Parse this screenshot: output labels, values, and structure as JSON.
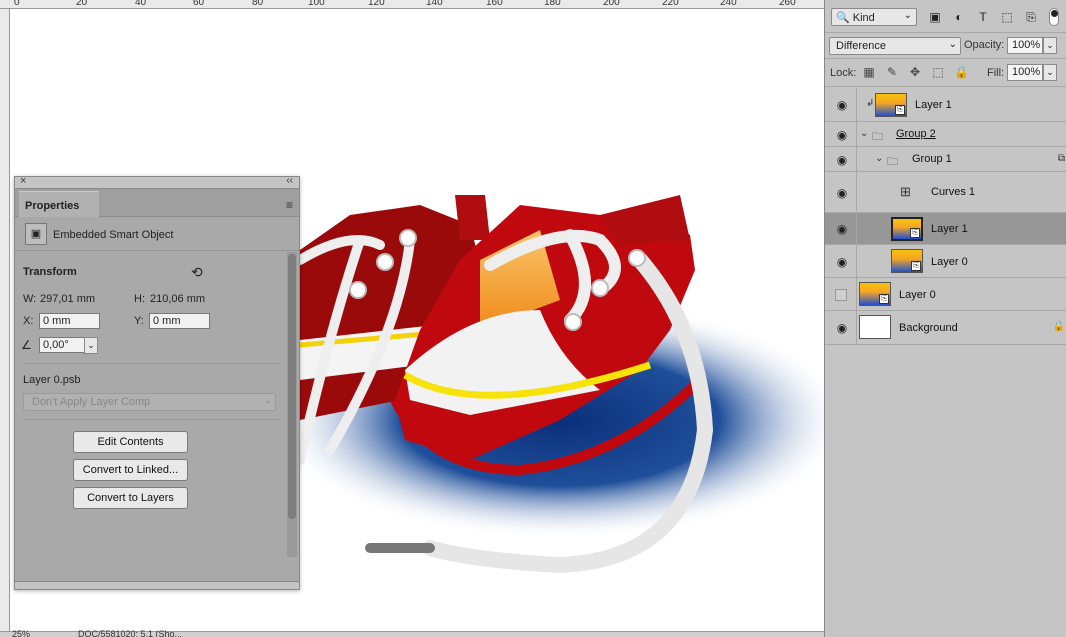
{
  "ruler": {
    "labels": [
      "0",
      "20",
      "40",
      "60",
      "80",
      "100",
      "120",
      "140",
      "160",
      "180",
      "200",
      "220",
      "240",
      "260"
    ]
  },
  "status": {
    "zoom": "25%",
    "doc": "DOC/5581020: 5.1 (Sho..."
  },
  "properties": {
    "close_glyph": "×",
    "collapse_glyph": "‹‹",
    "tab_label": "Properties",
    "menu_glyph": "≡",
    "type_label": "Embedded Smart Object",
    "transform_title": "Transform",
    "w_label": "W:",
    "w_value": "297,01 mm",
    "h_label": "H:",
    "h_value": "210,06 mm",
    "x_label": "X:",
    "x_value": "0 mm",
    "y_label": "Y:",
    "y_value": "0 mm",
    "angle_value": "0,00°",
    "file_name": "Layer 0.psb",
    "layer_comp": "Don't Apply Layer Comp",
    "buttons": {
      "edit": "Edit Contents",
      "linked": "Convert to Linked...",
      "layers": "Convert to Layers"
    }
  },
  "layers": {
    "kind_label": "Kind",
    "blend_mode": "Difference",
    "opacity_label": "Opacity:",
    "opacity_value": "100%",
    "lock_label": "Lock:",
    "fill_label": "Fill:",
    "fill_value": "100%",
    "items": [
      {
        "name": "Layer 1"
      },
      {
        "name": "Group 2"
      },
      {
        "name": "Group 1"
      },
      {
        "name": "Curves 1"
      },
      {
        "name": "Layer 1"
      },
      {
        "name": "Layer 0"
      },
      {
        "name": "Layer 0"
      },
      {
        "name": "Background"
      }
    ]
  },
  "colors": {
    "shoe_red": "#c0090f",
    "shadow_blue": "#1f4f9a",
    "panel_gray": "#a9a9a9",
    "layers_bg": "#c5c5c5"
  }
}
